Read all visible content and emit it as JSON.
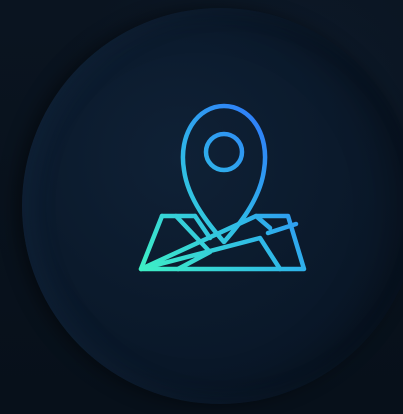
{
  "icon": {
    "name": "map-pin-icon",
    "gradient_start": "#3ef0c4",
    "gradient_end": "#2f6bff"
  },
  "colors": {
    "background": "#08111c",
    "disc": "#0b1a2c"
  }
}
